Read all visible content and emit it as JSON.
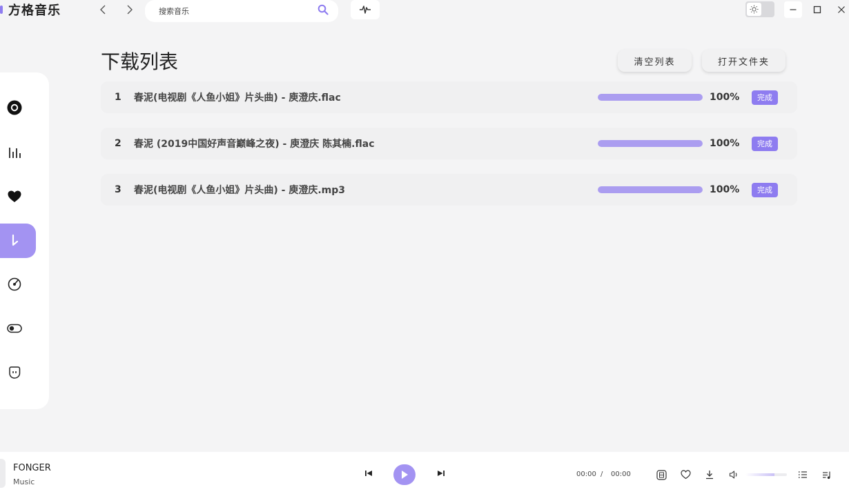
{
  "app": {
    "name": "方格音乐"
  },
  "search": {
    "placeholder": "搜索音乐"
  },
  "page": {
    "title": "下载列表",
    "actions": {
      "clear": "清空列表",
      "open_folder": "打开文件夹"
    }
  },
  "downloads": [
    {
      "index": "1",
      "name": "春泥(电视剧《人鱼小姐》片头曲) - 庾澄庆.flac",
      "progress": 100,
      "percent_text": "100%",
      "status": "完成"
    },
    {
      "index": "2",
      "name": "春泥 (2019中国好声音巅峰之夜) - 庾澄庆 陈其楠.flac",
      "progress": 100,
      "percent_text": "100%",
      "status": "完成"
    },
    {
      "index": "3",
      "name": "春泥(电视剧《人鱼小姐》片头曲) - 庾澄庆.mp3",
      "progress": 100,
      "percent_text": "100%",
      "status": "完成"
    }
  ],
  "sidebar": {
    "items": [
      {
        "icon": "disc-icon",
        "active": false
      },
      {
        "icon": "chart-bars-icon",
        "active": false
      },
      {
        "icon": "heart-icon",
        "active": false
      },
      {
        "icon": "download-icon",
        "active": true
      },
      {
        "icon": "vinyl-icon",
        "active": false
      },
      {
        "icon": "toggle-icon",
        "active": false
      },
      {
        "icon": "face-icon",
        "active": false
      }
    ]
  },
  "player": {
    "title": "FONGER",
    "artist": "Music",
    "current_time": "00:00",
    "separator": "/",
    "total_time": "00:00",
    "volume": 0.7
  },
  "colors": {
    "accent": "#8e7cf0",
    "accent_light": "#a393f2",
    "background": "#f4f4f5"
  }
}
